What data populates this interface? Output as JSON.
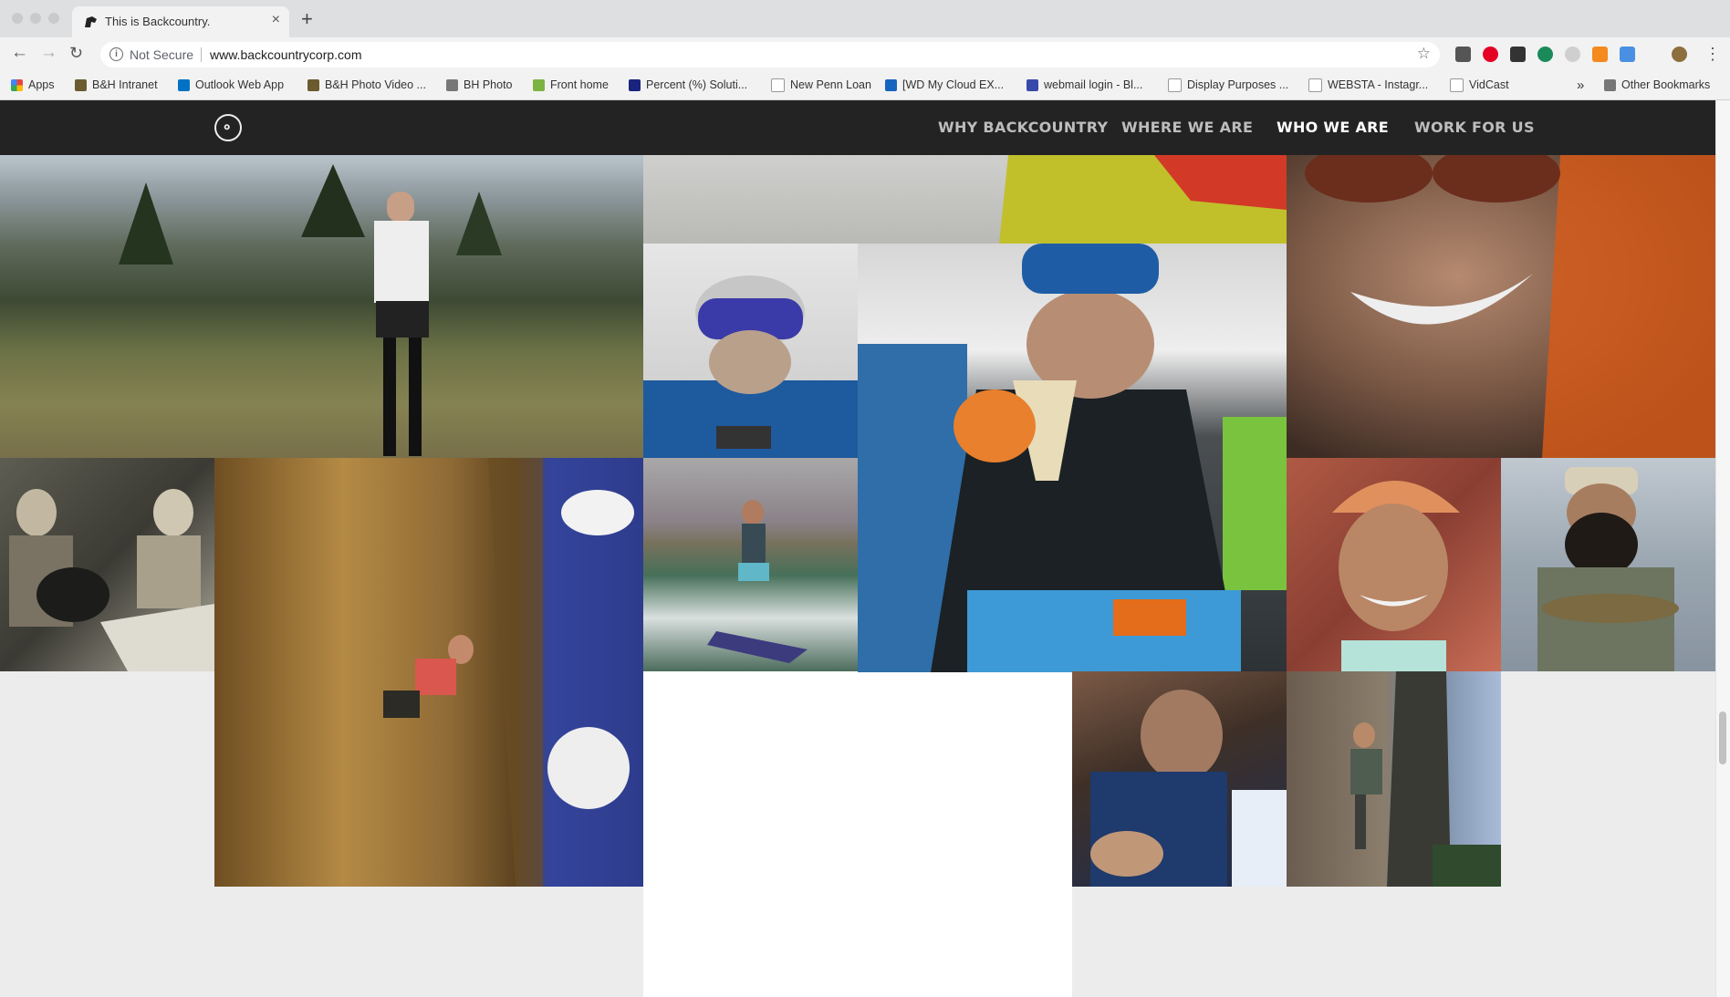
{
  "browser": {
    "tab_title": "This is Backcountry.",
    "security_label": "Not Secure",
    "url": "www.backcountrycorp.com",
    "new_tab_symbol": "+",
    "close_symbol": "×"
  },
  "bookmarks": [
    {
      "label": "Apps",
      "color": "#e8453c"
    },
    {
      "label": "B&H Intranet",
      "color": "#6b5b2e"
    },
    {
      "label": "Outlook Web App",
      "color": "#0072c6"
    },
    {
      "label": "B&H Photo Video ...",
      "color": "#6b5b2e"
    },
    {
      "label": "BH Photo",
      "color": "#777777"
    },
    {
      "label": "Front home",
      "color": "#7cb342"
    },
    {
      "label": "Percent (%) Soluti...",
      "color": "#1a237e"
    },
    {
      "label": "New Penn Loan",
      "color": "#999999"
    },
    {
      "label": "[WD My Cloud EX...",
      "color": "#1565c0"
    },
    {
      "label": "webmail login - Bl...",
      "color": "#3949ab"
    },
    {
      "label": "Display Purposes ...",
      "color": "#999999"
    },
    {
      "label": "WEBSTA - Instagr...",
      "color": "#999999"
    },
    {
      "label": "VidCast",
      "color": "#999999"
    }
  ],
  "bookmarks_overflow": "»",
  "other_bookmarks": "Other Bookmarks",
  "nav": {
    "items": [
      "WHY BACKCOUNTRY",
      "WHERE WE ARE",
      "WHO WE ARE",
      "WORK FOR US"
    ],
    "active": "WHO WE ARE"
  },
  "colors": {
    "nav_bg": "#232323",
    "nav_text": "#bdbdbd",
    "nav_active": "#ffffff",
    "page_bg": "#ececec"
  }
}
